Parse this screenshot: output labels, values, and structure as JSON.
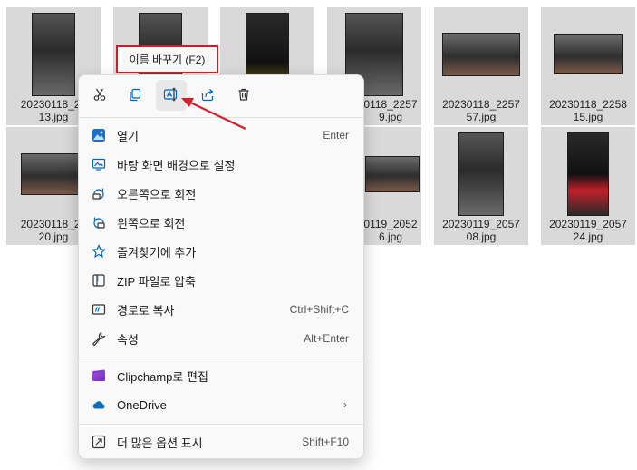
{
  "files": [
    {
      "name": "20230118_22\n13.jpg",
      "thumb": "v"
    },
    {
      "name": "",
      "thumb": "v"
    },
    {
      "name": "",
      "thumb": "v"
    },
    {
      "name": "0118_2257\n9.jpg",
      "thumb": "v"
    },
    {
      "name": "20230118_2257\n57.jpg",
      "thumb": "h"
    },
    {
      "name": "20230118_2258\n15.jpg",
      "thumb": "h"
    },
    {
      "name": "20230118_22\n20.jpg",
      "thumb": "h"
    },
    {
      "name": "",
      "thumb": "h"
    },
    {
      "name": "",
      "thumb": "h"
    },
    {
      "name": "0119_2052\n6.jpg",
      "thumb": "h"
    },
    {
      "name": "20230119_2057\n08.jpg",
      "thumb": "v"
    },
    {
      "name": "20230119_2057\n24.jpg",
      "thumb": "red"
    }
  ],
  "tooltip": {
    "text": "이름 바꾸기 (F2)"
  },
  "iconbar": [
    {
      "icon": "cut-icon"
    },
    {
      "icon": "copy-icon"
    },
    {
      "icon": "rename-icon"
    },
    {
      "icon": "share-icon"
    },
    {
      "icon": "delete-icon"
    }
  ],
  "menu": {
    "items": [
      {
        "label": "열기",
        "shortcut": "Enter",
        "icon": "photos-app-icon"
      },
      {
        "label": "바탕 화면 배경으로 설정",
        "shortcut": "",
        "icon": "desktop-background-icon"
      },
      {
        "label": "오른쪽으로 회전",
        "shortcut": "",
        "icon": "rotate-right-icon"
      },
      {
        "label": "왼쪽으로 회전",
        "shortcut": "",
        "icon": "rotate-left-icon"
      },
      {
        "label": "즐겨찾기에 추가",
        "shortcut": "",
        "icon": "star-icon"
      },
      {
        "label": "ZIP 파일로 압축",
        "shortcut": "",
        "icon": "zip-folder-icon"
      },
      {
        "label": "경로로 복사",
        "shortcut": "Ctrl+Shift+C",
        "icon": "copy-path-icon"
      },
      {
        "label": "속성",
        "shortcut": "Alt+Enter",
        "icon": "wrench-icon"
      },
      {
        "label": "Clipchamp로 편집",
        "shortcut": "",
        "icon": "clipchamp-icon"
      },
      {
        "label": "OneDrive",
        "shortcut": "",
        "icon": "onedrive-icon",
        "submenu": true
      },
      {
        "label": "더 많은 옵션 표시",
        "shortcut": "Shift+F10",
        "icon": "more-options-icon"
      }
    ]
  },
  "colors": {
    "highlight": "#c8202a",
    "accent": "#0067c0"
  }
}
